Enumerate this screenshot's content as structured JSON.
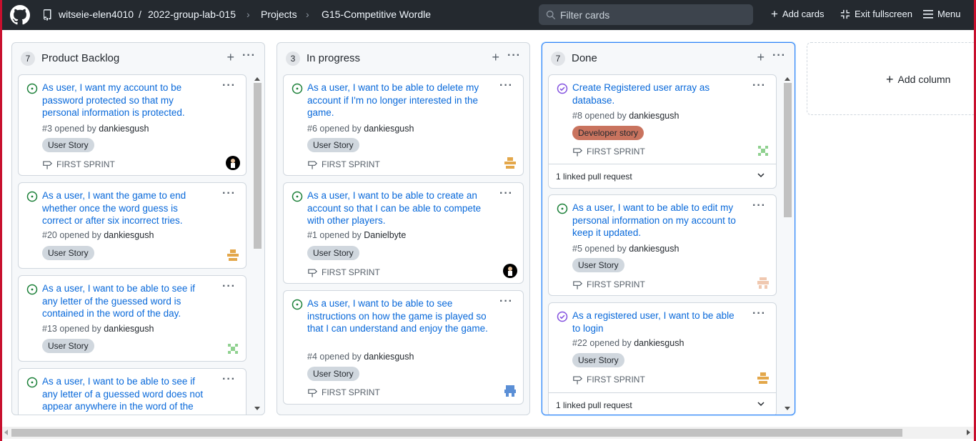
{
  "header": {
    "owner": "witseie-elen4010",
    "separator": "/",
    "repo": "2022-group-lab-015",
    "projects": "Projects",
    "project_name": "G15-Competitive Wordle",
    "search_placeholder": "Filter cards",
    "add_cards": "Add cards",
    "exit_fullscreen": "Exit fullscreen",
    "menu": "Menu"
  },
  "columns": [
    {
      "count": "7",
      "title": "Product Backlog",
      "cards": [
        {
          "title": "As user, I want my account to be password protected so that my personal information is protected.",
          "number": "#3",
          "opened_by": "opened by",
          "user": "dankiesgush",
          "label": "User Story",
          "milestone": "FIRST SPRINT"
        },
        {
          "title": "As a user, I want the game to end whether once the word guess is correct or after six incorrect tries.",
          "number": "#20",
          "opened_by": "opened by",
          "user": "dankiesgush",
          "label": "User Story"
        },
        {
          "title": "As a user, I want to be able to see if any letter of the guessed word is contained in the word of the day.",
          "number": "#13",
          "opened_by": "opened by",
          "user": "dankiesgush",
          "label": "User Story"
        },
        {
          "title": "As a user, I want to be able to see if any letter of a guessed word does not appear anywhere in the word of the day."
        }
      ]
    },
    {
      "count": "3",
      "title": "In progress",
      "cards": [
        {
          "title": "As a user, I want to be able to delete my account if I'm no longer interested in the game.",
          "number": "#6",
          "opened_by": "opened by",
          "user": "dankiesgush",
          "label": "User Story",
          "milestone": "FIRST SPRINT"
        },
        {
          "title": "As a user, I want to be able to create an account so that I can be able to compete with other players.",
          "number": "#1",
          "opened_by": "opened by",
          "user": "Danielbyte",
          "label": "User Story",
          "milestone": "FIRST SPRINT"
        },
        {
          "title": "As a user, I want to be able to see instructions on how the game is played so that I can understand and enjoy the game.",
          "number": "#4",
          "opened_by": "opened by",
          "user": "dankiesgush",
          "label": "User Story",
          "milestone": "FIRST SPRINT"
        }
      ]
    },
    {
      "count": "7",
      "title": "Done",
      "cards": [
        {
          "title": "Create Registered user array as database.",
          "number": "#8",
          "opened_by": "opened by",
          "user": "dankiesgush",
          "label": "Developer story",
          "milestone": "FIRST SPRINT",
          "pr": "1 linked pull request"
        },
        {
          "title": "As a user, I want to be able to edit my personal information on my account to keep it updated.",
          "number": "#5",
          "opened_by": "opened by",
          "user": "dankiesgush",
          "label": "User Story",
          "milestone": "FIRST SPRINT"
        },
        {
          "title": "As a registered user, I want to be able to login",
          "number": "#22",
          "opened_by": "opened by",
          "user": "dankiesgush",
          "label": "User Story",
          "milestone": "FIRST SPRINT",
          "pr": "1 linked pull request"
        }
      ]
    }
  ],
  "add_column": "Add column",
  "icons": {
    "open_issue": "issue-opened-icon",
    "closed_issue": "issue-closed-icon",
    "milestone": "milestone-icon"
  },
  "colors": {
    "open_issue": "#1a7f37",
    "closed_issue": "#8250df",
    "developer_story": "#c9735e",
    "link": "#0969da"
  }
}
